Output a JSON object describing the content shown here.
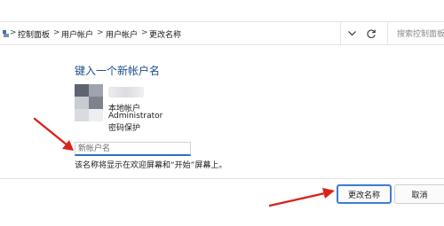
{
  "address_bar": {
    "breadcrumbs": [
      {
        "label": "控制面板"
      },
      {
        "label": "用户帐户"
      },
      {
        "label": "用户帐户"
      },
      {
        "label": "更改名称"
      }
    ],
    "separator": ">",
    "search_placeholder": "搜索控制面板"
  },
  "main": {
    "heading": "键入一个新帐户名",
    "account": {
      "type": "本地帐户",
      "name": "Administrator",
      "protection": "密码保护"
    },
    "name_input": {
      "value": "",
      "placeholder": "新帐户名"
    },
    "hint": "该名称将显示在欢迎屏幕和“开始”屏幕上。"
  },
  "footer": {
    "confirm_label": "更改名称",
    "cancel_label": "取消"
  },
  "colors": {
    "heading": "#1e4f8c",
    "accent": "#2f6fc4",
    "annotation_arrow": "#d9221e"
  }
}
